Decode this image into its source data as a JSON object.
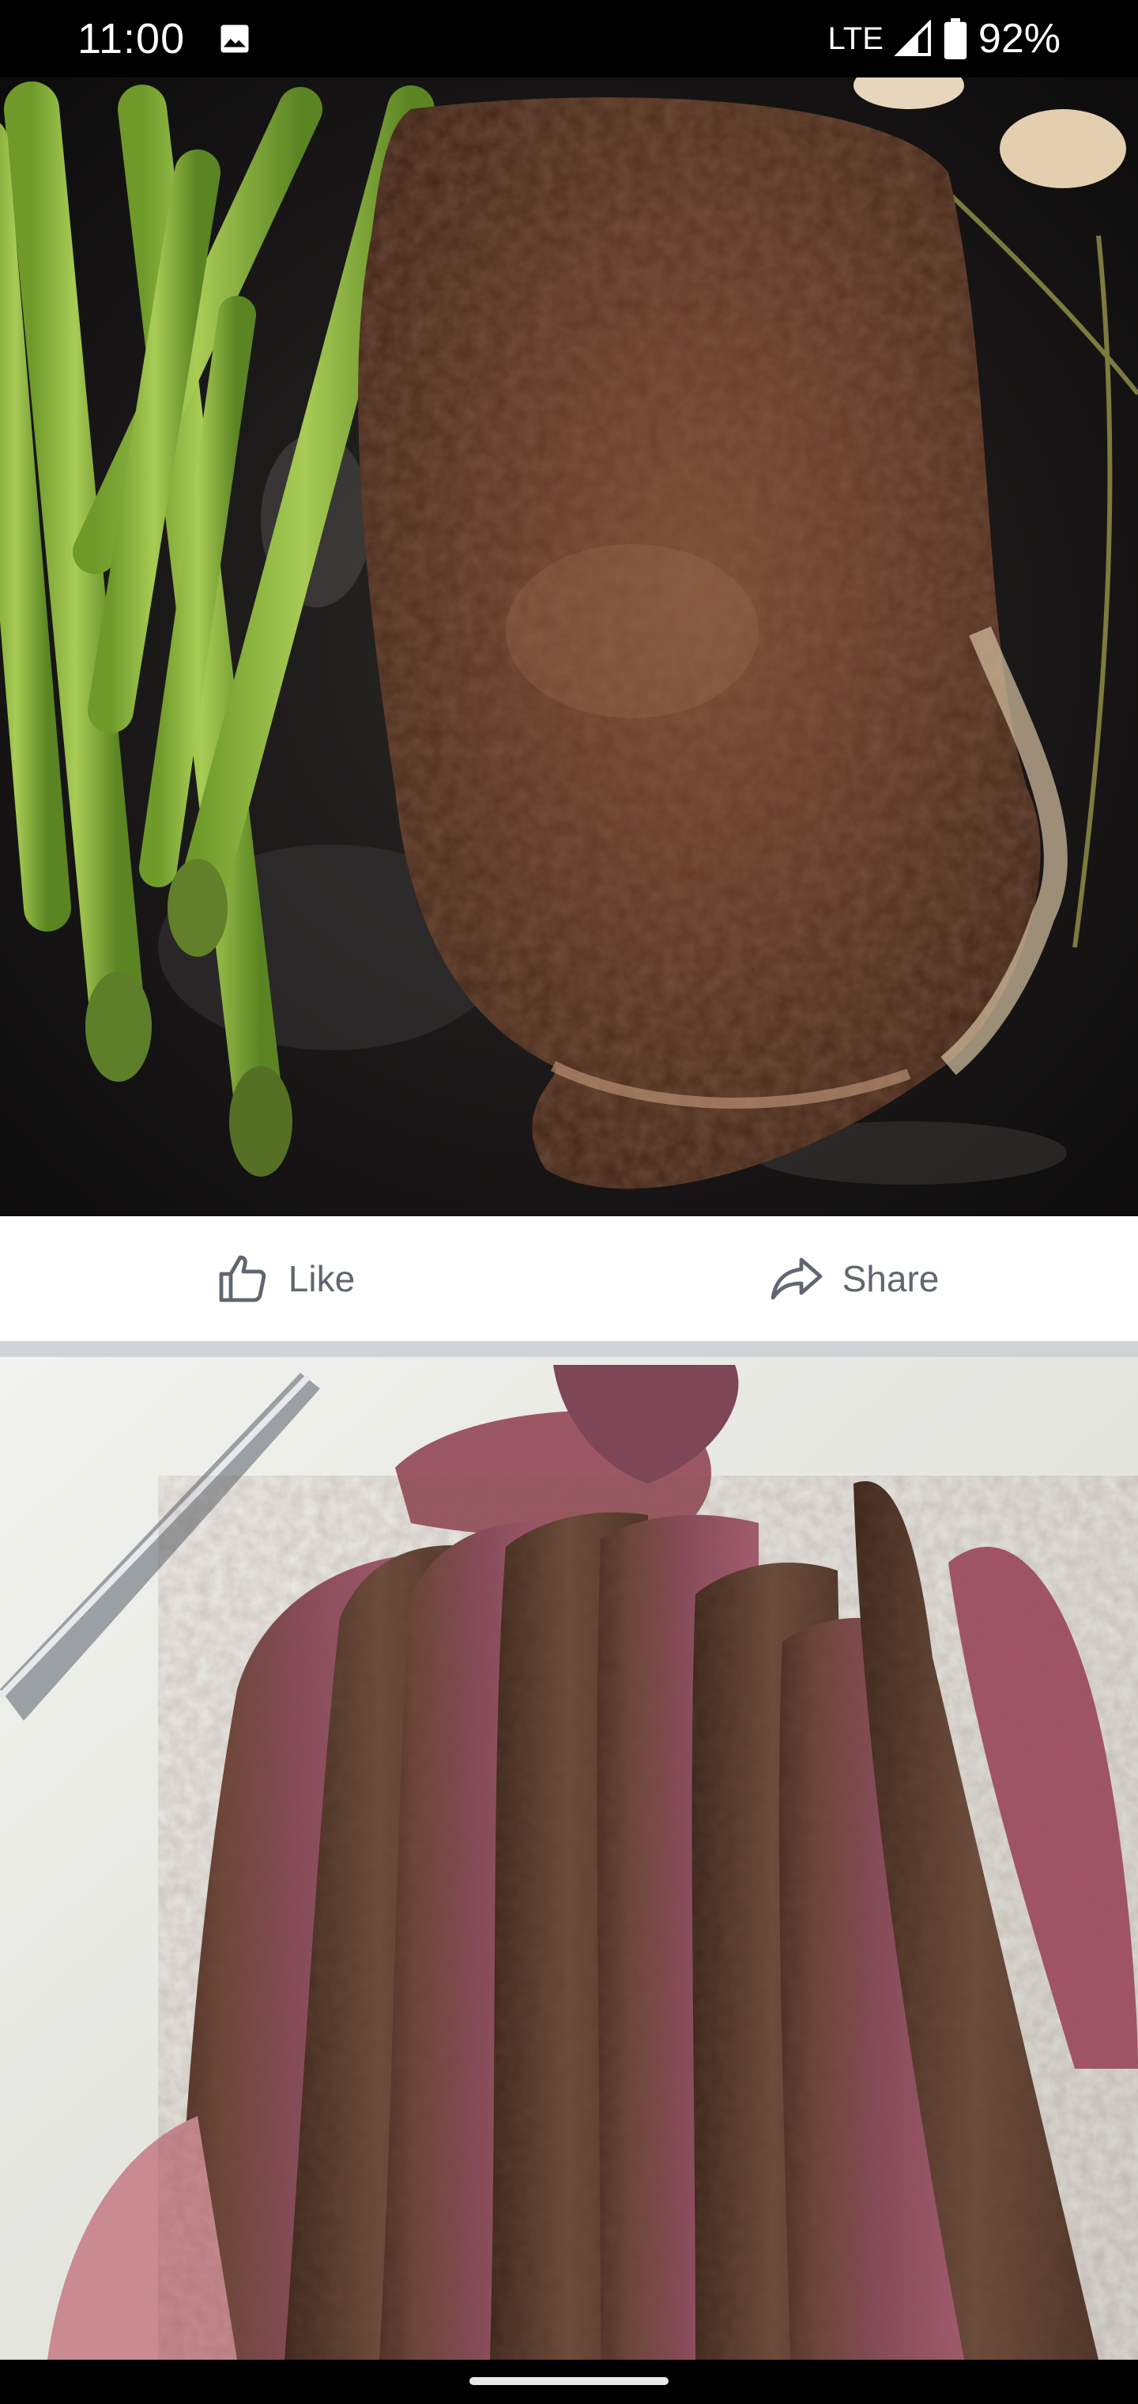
{
  "status_bar": {
    "time": "11:00",
    "network": "LTE",
    "battery": "92%"
  },
  "post": {
    "photos": [
      {
        "icon": "seared-steak-with-asparagus-photo"
      },
      {
        "icon": "sliced-steak-on-cutting-board-photo"
      }
    ],
    "actions": {
      "like_label": "Like",
      "share_label": "Share"
    }
  },
  "colors": {
    "action_text": "#606770",
    "action_bar_bg": "#ffffff",
    "divider": "#cfd2d6"
  }
}
